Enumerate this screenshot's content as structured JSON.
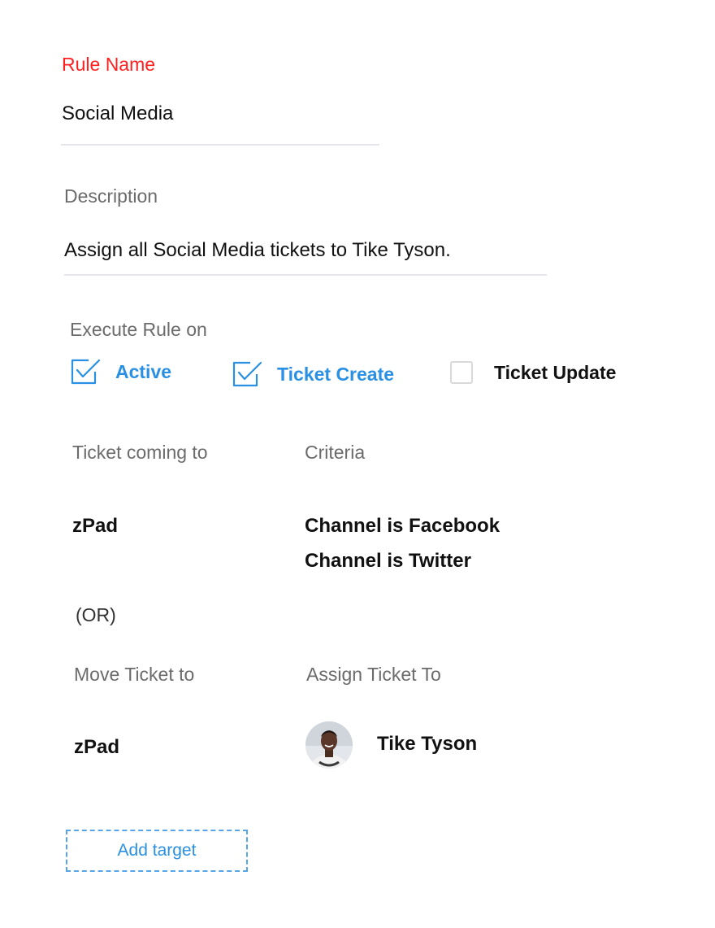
{
  "rule_name": {
    "label": "Rule Name",
    "value": "Social Media"
  },
  "description": {
    "label": "Description",
    "value": "Assign all Social Media tickets to Tike Tyson."
  },
  "execute_rule": {
    "label": "Execute Rule on",
    "options": [
      {
        "label": "Active",
        "checked": true
      },
      {
        "label": "Ticket Create",
        "checked": true
      },
      {
        "label": "Ticket Update",
        "checked": false
      }
    ]
  },
  "ticket_coming_to": {
    "label": "Ticket coming to",
    "value": "zPad"
  },
  "criteria": {
    "label": "Criteria",
    "conditions": [
      "Channel is Facebook",
      "Channel is Twitter"
    ]
  },
  "or_separator": "(OR)",
  "move_ticket_to": {
    "label": "Move Ticket to",
    "value": "zPad"
  },
  "assign_ticket_to": {
    "label": "Assign Ticket To",
    "assignee": "Tike Tyson",
    "avatar_icon": "user-avatar"
  },
  "add_target_label": "Add target",
  "colors": {
    "accent": "#2a90e4",
    "required_label": "#ff1f1f",
    "muted_label": "#6b6b6b",
    "divider": "#e6e6ec"
  }
}
